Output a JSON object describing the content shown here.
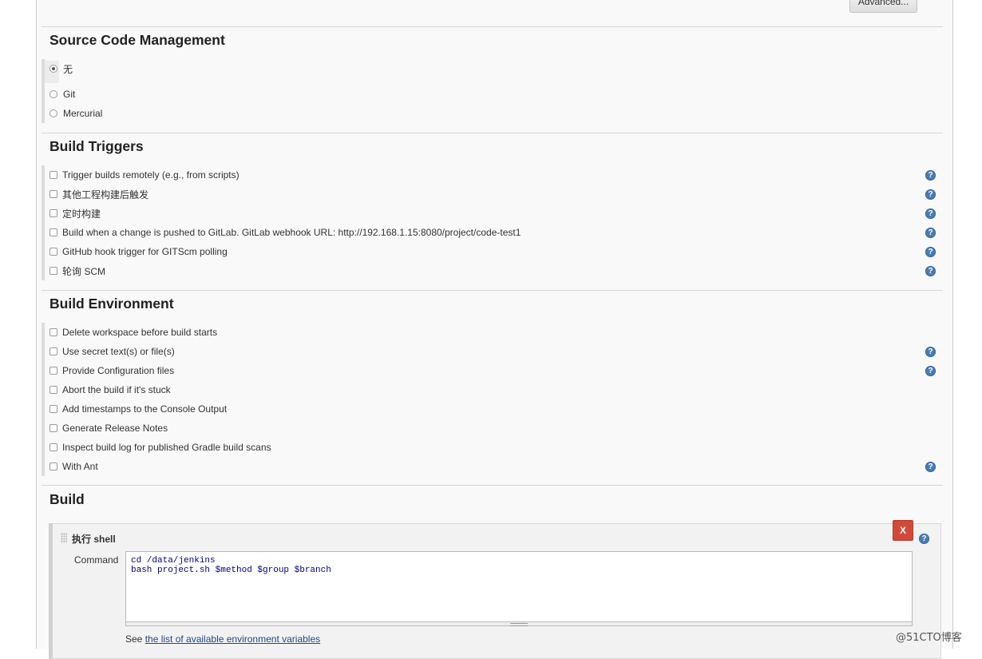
{
  "top": {
    "advanced_label": "Advanced..."
  },
  "scm": {
    "title": "Source Code Management",
    "options": [
      {
        "label": "无",
        "checked": true
      },
      {
        "label": "Git",
        "checked": false
      },
      {
        "label": "Mercurial",
        "checked": false
      }
    ]
  },
  "triggers": {
    "title": "Build Triggers",
    "options": [
      {
        "label": "Trigger builds remotely (e.g., from scripts)",
        "help": true
      },
      {
        "label": "其他工程构建后触发",
        "help": true
      },
      {
        "label": "定时构建",
        "help": true
      },
      {
        "label": "Build when a change is pushed to GitLab. GitLab webhook URL: http://192.168.1.15:8080/project/code-test1",
        "help": true
      },
      {
        "label": "GitHub hook trigger for GITScm polling",
        "help": true
      },
      {
        "label": "轮询 SCM",
        "help": true
      }
    ]
  },
  "environment": {
    "title": "Build Environment",
    "options": [
      {
        "label": "Delete workspace before build starts",
        "help": false
      },
      {
        "label": "Use secret text(s) or file(s)",
        "help": true
      },
      {
        "label": "Provide Configuration files",
        "help": true
      },
      {
        "label": "Abort the build if it's stuck",
        "help": false
      },
      {
        "label": "Add timestamps to the Console Output",
        "help": false
      },
      {
        "label": "Generate Release Notes",
        "help": false
      },
      {
        "label": "Inspect build log for published Gradle build scans",
        "help": false
      },
      {
        "label": "With Ant",
        "help": true
      }
    ]
  },
  "build": {
    "title": "Build",
    "shell": {
      "title": "执行 shell",
      "delete_label": "X",
      "command_label": "Command",
      "command_value": "cd /data/jenkins\nbash project.sh $method $group $branch",
      "see_prefix": "See ",
      "see_link": "the list of available environment variables"
    }
  },
  "help_glyph": "?",
  "watermark": "@51CTO博客",
  "icons": {
    "help": "help-icon",
    "drag": "drag-handle-icon"
  }
}
